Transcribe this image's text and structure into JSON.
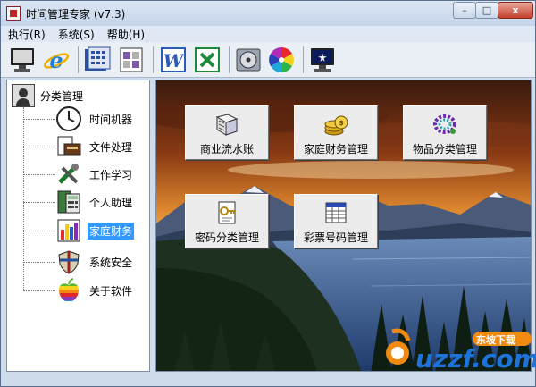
{
  "window": {
    "title": "时间管理专家  (v7.3)",
    "minimize_glyph": "–",
    "maximize_glyph": "□",
    "close_glyph": "x"
  },
  "menu": [
    "执行(R)",
    "系统(S)",
    "帮助(H)"
  ],
  "toolbar": {
    "buttons": [
      "monitor-icon",
      "ie-browser-icon",
      "calculator-icon",
      "organizer-icon",
      "word-icon",
      "excel-icon",
      "disc-drive-icon",
      "color-wheel-icon",
      "screen-icon"
    ]
  },
  "tree": {
    "root_label": "分类管理",
    "items": [
      {
        "label": "时间机器",
        "icon": "clock-icon"
      },
      {
        "label": "文件处理",
        "icon": "file-printer-icon"
      },
      {
        "label": "工作学习",
        "icon": "tools-icon"
      },
      {
        "label": "个人助理",
        "icon": "calculator-book-icon"
      },
      {
        "label": "家庭财务",
        "icon": "bar-chart-icon",
        "selected": true
      },
      {
        "label": "系统安全",
        "icon": "shield-icon"
      },
      {
        "label": "关于软件",
        "icon": "apple-icon"
      }
    ]
  },
  "functions": [
    {
      "label": "商业流水账",
      "icon": "ledger-icon"
    },
    {
      "label": "家庭财务管理",
      "icon": "coins-icon"
    },
    {
      "label": "物品分类管理",
      "icon": "beads-icon"
    },
    {
      "label": "密码分类管理",
      "icon": "key-document-icon"
    },
    {
      "label": "彩票号码管理",
      "icon": "lottery-table-icon"
    }
  ],
  "watermark": {
    "text": "uzzf.com",
    "badge": "东坡下载"
  },
  "colors": {
    "selection": "#3399ff",
    "chrome": "#cfdcec",
    "watermark_orange": "#f08a10",
    "watermark_blue": "#1e73d8"
  }
}
